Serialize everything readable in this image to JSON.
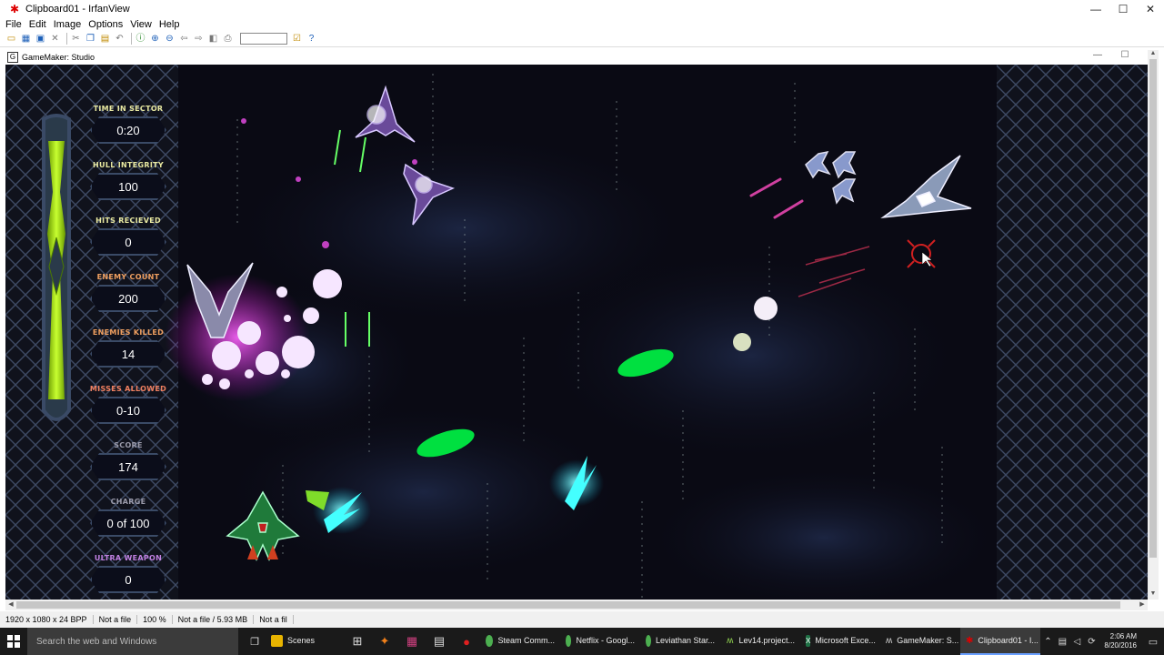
{
  "window": {
    "title": "Clipboard01 - IrfanView",
    "controls": [
      "minimize",
      "maximize",
      "close"
    ]
  },
  "menu": [
    "File",
    "Edit",
    "Image",
    "Options",
    "View",
    "Help"
  ],
  "toolbar": {
    "buttons": [
      "open-icon",
      "thumbnails-icon",
      "save-icon",
      "delete-icon",
      "cut-icon",
      "copy-icon",
      "paste-icon",
      "undo-icon",
      "info-icon",
      "zoom-in-icon",
      "zoom-out-icon",
      "previous-icon",
      "next-icon",
      "slideshow-icon",
      "print-icon",
      "options-icon",
      "help-icon"
    ],
    "zoom_input": ""
  },
  "inner_window": {
    "title": "GameMaker: Studio"
  },
  "hud": [
    {
      "label": "TIME IN SECTOR",
      "value": "0:20",
      "color": "#e8e8a0"
    },
    {
      "label": "HULL INTEGRITY",
      "value": "100",
      "color": "#e8e8a0"
    },
    {
      "label": "HITS RECIEVED",
      "value": "0",
      "color": "#e8e8a0"
    },
    {
      "label": "ENEMY COUNT",
      "value": "200",
      "color": "#f0a060"
    },
    {
      "label": "ENEMIES KILLED",
      "value": "14",
      "color": "#f0a060"
    },
    {
      "label": "MISSES ALLOWED",
      "value": "0-10",
      "color": "#f08060"
    },
    {
      "label": "SCORE",
      "value": "174",
      "color": "#9a9aaa"
    },
    {
      "label": "CHARGE",
      "value": "0 of 100",
      "color": "#9a9aaa"
    },
    {
      "label": "ULTRA WEAPON",
      "value": "0",
      "color": "#c080e0"
    }
  ],
  "health_bar": {
    "level": 1.0,
    "color": "#a8e000"
  },
  "status": [
    "1920 x 1080 x 24 BPP",
    "Not a file",
    "100 %",
    "Not a file / 5.93 MB",
    "Not a fil"
  ],
  "taskbar": {
    "search_placeholder": "Search the web and Windows",
    "tasks": [
      {
        "label": "Scenes",
        "icon": "folder-icon",
        "color": "#e8b400"
      },
      {
        "label": "Steam Comm...",
        "icon": "chrome-icon",
        "color": "#4caf50"
      },
      {
        "label": "Netflix - Googl...",
        "icon": "chrome-icon",
        "color": "#4caf50"
      },
      {
        "label": "Leviathan Star...",
        "icon": "chrome-icon",
        "color": "#4caf50"
      },
      {
        "label": "Lev14.project...",
        "icon": "gamemaker-icon",
        "color": "#8fd14f"
      },
      {
        "label": "Microsoft Exce...",
        "icon": "excel-icon",
        "color": "#1e7145"
      },
      {
        "label": "GameMaker: S...",
        "icon": "gamemaker-icon",
        "color": "#cccccc"
      },
      {
        "label": "Clipboard01 - I...",
        "icon": "irfanview-icon",
        "color": "#d00000"
      }
    ],
    "clock_time": "2:06 AM",
    "clock_date": "8/20/2016"
  }
}
